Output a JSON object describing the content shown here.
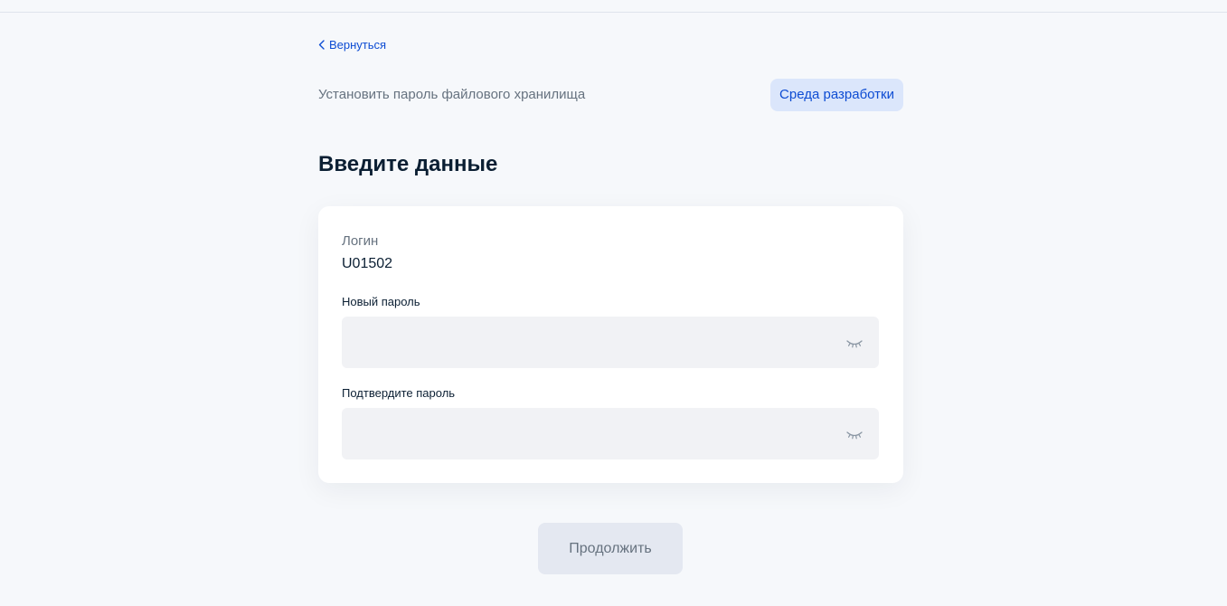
{
  "nav": {
    "back_label": "Вернуться",
    "back_icon": "chevron-left-icon"
  },
  "header": {
    "service_title": "Установить пароль файлового хранилища",
    "env_badge": "Среда разработки"
  },
  "main": {
    "title": "Введите данные",
    "login": {
      "label": "Логин",
      "value": "U01502"
    },
    "new_password": {
      "label": "Новый пароль",
      "value": "",
      "placeholder": "",
      "toggle_icon": "eye-closed-icon"
    },
    "confirm_password": {
      "label": "Подтвердите пароль",
      "value": "",
      "placeholder": "",
      "toggle_icon": "eye-closed-icon"
    },
    "continue_label": "Продолжить"
  },
  "colors": {
    "accent": "#0d4cd3",
    "badge_bg": "#dbe6fb",
    "page_bg": "#f6f8fb",
    "field_bg": "#f1f2f5",
    "button_disabled_bg": "#e4e8f1",
    "muted_text": "#66727f"
  }
}
